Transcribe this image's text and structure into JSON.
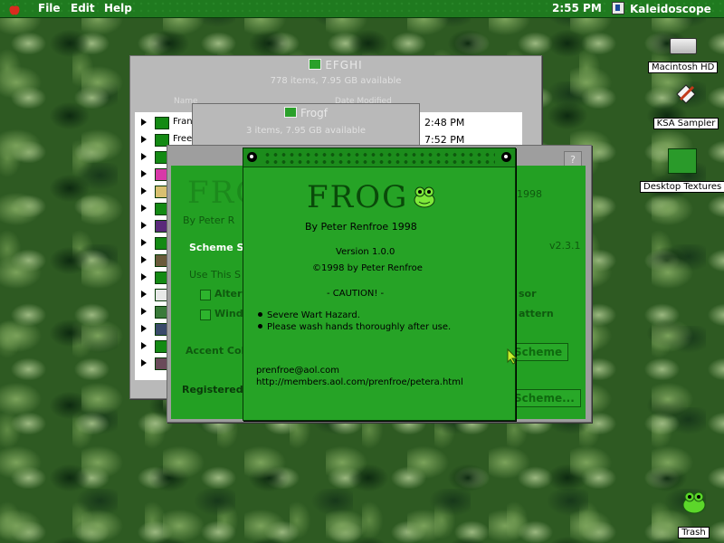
{
  "menubar": {
    "items": [
      "File",
      "Edit",
      "Help"
    ],
    "clock": "2:55 PM",
    "app_name": "Kaleidoscope"
  },
  "desktop_icons": {
    "hd": "Macintosh HD",
    "ksa": "KSA Sampler",
    "textures": "Desktop Textures",
    "trash": "Trash"
  },
  "window_efghi": {
    "title": "EFGHI",
    "subtitle": "778 items, 7.95 GB available",
    "col_name": "Name",
    "col_date": "Date Modified",
    "rows": [
      {
        "name": "Fran",
        "date": "2:48 PM"
      },
      {
        "name": "Free",
        "date": "7:52 PM"
      }
    ]
  },
  "window_frogf": {
    "title": "Frogf",
    "subtitle": "3 items, 7.95 GB available"
  },
  "control_panel": {
    "logo": "FROG",
    "by": "By Peter R",
    "year": "1998",
    "version": "v2.3.1",
    "scheme_label": "Scheme S",
    "use_this": "Use This S",
    "alter": "Alter",
    "wind": "Wind",
    "sor": "sor",
    "attern": "attern",
    "accent": "Accent Col",
    "scheme_btn": "Scheme",
    "registered": "Registered",
    "scheme_btn2": "Scheme...",
    "help": "?"
  },
  "about": {
    "logo": "FROG",
    "byline": "By Peter Renfroe   1998",
    "version": "Version 1.0.0",
    "copyright": "©1998 by Peter Renfroe",
    "caution": "- CAUTION! -",
    "bullets": [
      "Severe Wart Hazard.",
      "Please wash hands thoroughly after use."
    ],
    "email": "prenfroe@aol.com",
    "url": "http://members.aol.com/prenfroe/petera.html"
  },
  "colors": {
    "menubar": "#1f7a1f",
    "dialog_green": "#26a326",
    "panel_green": "#23a023"
  }
}
